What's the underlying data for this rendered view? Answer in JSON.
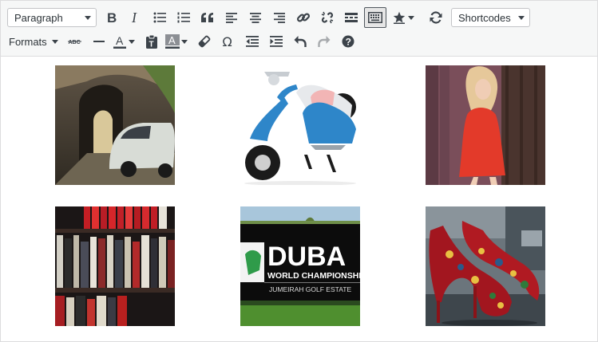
{
  "toolbar": {
    "row1": {
      "format_select": {
        "value": "Paragraph"
      },
      "shortcodes_select": {
        "value": "Shortcodes"
      },
      "buttons": [
        "bold-icon",
        "italic-icon",
        "bullet-list-icon",
        "numbered-list-icon",
        "blockquote-icon",
        "align-left-icon",
        "align-center-icon",
        "align-right-icon",
        "link-icon",
        "unlink-icon",
        "read-more-icon",
        "toolbar-toggle-icon",
        "star-icon",
        "refresh-icon"
      ]
    },
    "row2": {
      "formats_label": "Formats",
      "buttons": [
        "strikethrough-icon",
        "horizontal-line-icon",
        "text-color-icon",
        "paste-as-text-icon",
        "background-color-icon",
        "clear-formatting-icon",
        "special-character-icon",
        "outdent-icon",
        "indent-icon",
        "undo-icon",
        "redo-icon",
        "help-icon"
      ]
    },
    "colors": {
      "icon": "#3c434a",
      "disabled": "#a7aaad",
      "bar": "#f6f7f7",
      "border": "#dcdcde"
    }
  },
  "gallery": {
    "images": [
      {
        "subject": "car-in-alley-image"
      },
      {
        "subject": "scooter-image"
      },
      {
        "subject": "woman-red-dress-image"
      },
      {
        "subject": "bookshelf-image"
      },
      {
        "subject": "golf-banner-image",
        "banner_line1": "DUBA",
        "banner_line2": "WORLD CHAMPIONSHIP",
        "banner_line3": "JUMEIRAH GOLF ESTATE"
      },
      {
        "subject": "red-shoes-image"
      }
    ]
  }
}
